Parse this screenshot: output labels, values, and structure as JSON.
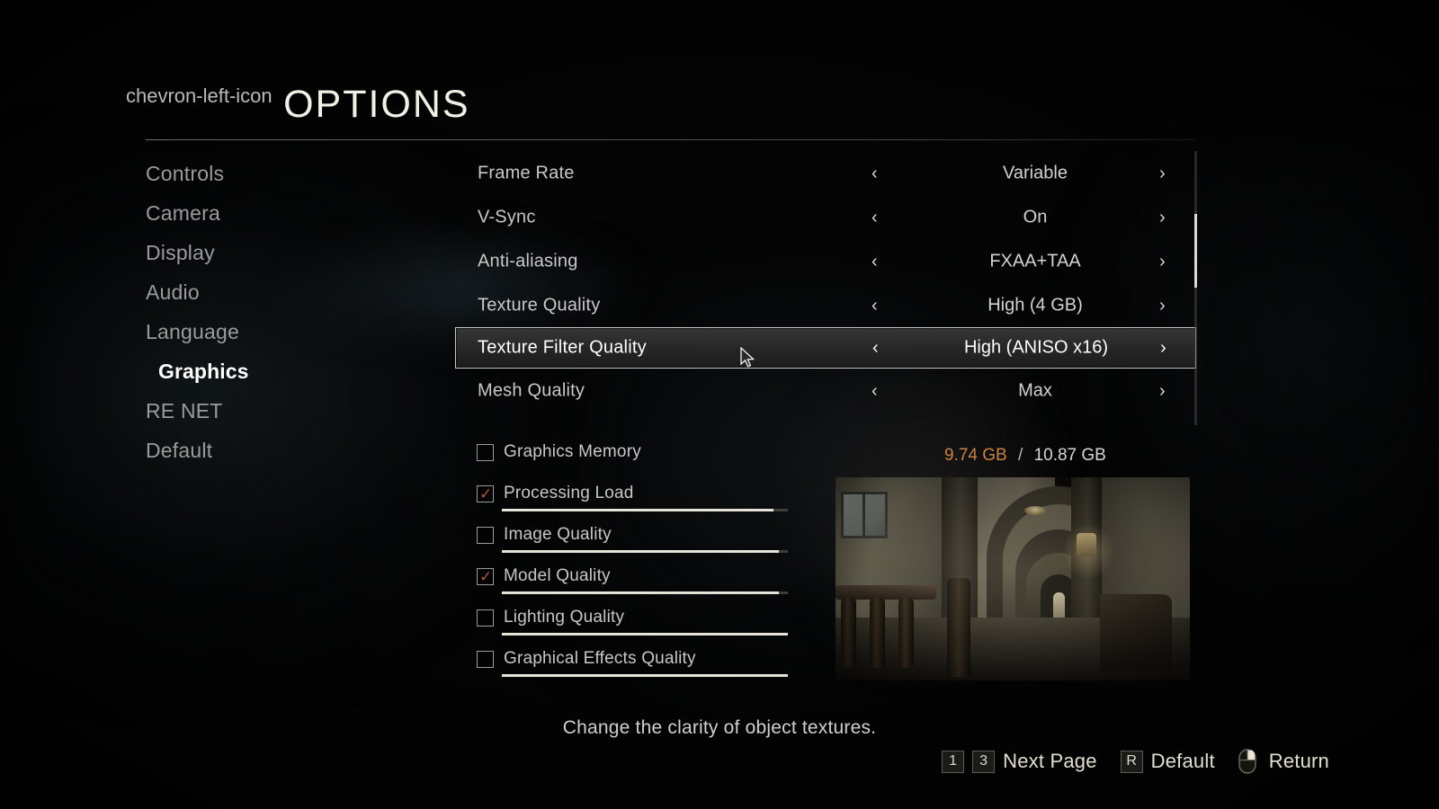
{
  "header": {
    "back_icon": "chevron-left-icon",
    "title": "OPTIONS"
  },
  "sidebar": {
    "items": [
      {
        "label": "Controls",
        "active": false
      },
      {
        "label": "Camera",
        "active": false
      },
      {
        "label": "Display",
        "active": false
      },
      {
        "label": "Audio",
        "active": false
      },
      {
        "label": "Language",
        "active": false
      },
      {
        "label": "Graphics",
        "active": true
      },
      {
        "label": "RE NET",
        "active": false
      },
      {
        "label": "Default",
        "active": false
      }
    ]
  },
  "settings": {
    "left_arrow": "‹",
    "right_arrow": "›",
    "rows": [
      {
        "label": "Frame Rate",
        "value": "Variable",
        "selected": false
      },
      {
        "label": "V-Sync",
        "value": "On",
        "selected": false
      },
      {
        "label": "Anti-aliasing",
        "value": "FXAA+TAA",
        "selected": false
      },
      {
        "label": "Texture Quality",
        "value": "High (4 GB)",
        "selected": false
      },
      {
        "label": "Texture Filter Quality",
        "value": "High (ANISO x16)",
        "selected": true
      },
      {
        "label": "Mesh Quality",
        "value": "Max",
        "selected": false
      }
    ]
  },
  "meters": {
    "items": [
      {
        "label": "Graphics Memory",
        "checked": false,
        "has_bar": false,
        "fill_percent": 0
      },
      {
        "label": "Processing Load",
        "checked": true,
        "has_bar": true,
        "fill_percent": 95
      },
      {
        "label": "Image Quality",
        "checked": false,
        "has_bar": true,
        "fill_percent": 97
      },
      {
        "label": "Model Quality",
        "checked": true,
        "has_bar": true,
        "fill_percent": 97
      },
      {
        "label": "Lighting Quality",
        "checked": false,
        "has_bar": true,
        "fill_percent": 100
      },
      {
        "label": "Graphical Effects Quality",
        "checked": false,
        "has_bar": true,
        "fill_percent": 100
      }
    ],
    "check_glyph": "✓",
    "check_color": "#b4564a"
  },
  "memory": {
    "used": "9.74 GB",
    "separator": "/",
    "total": "10.87 GB",
    "used_color": "#c8834a"
  },
  "preview": {
    "alt": "mansion-corridor-preview"
  },
  "description": {
    "text": "Change the clarity of object textures."
  },
  "footer": {
    "prompts": [
      {
        "type": "key",
        "key": "1"
      },
      {
        "type": "key",
        "key": "3"
      },
      {
        "type": "text",
        "text": "Next Page"
      },
      {
        "type": "key",
        "key": "R"
      },
      {
        "type": "text",
        "text": "Default"
      },
      {
        "type": "mouse",
        "icon": "mouse-right-button-icon"
      },
      {
        "type": "text",
        "text": "Return"
      }
    ]
  }
}
